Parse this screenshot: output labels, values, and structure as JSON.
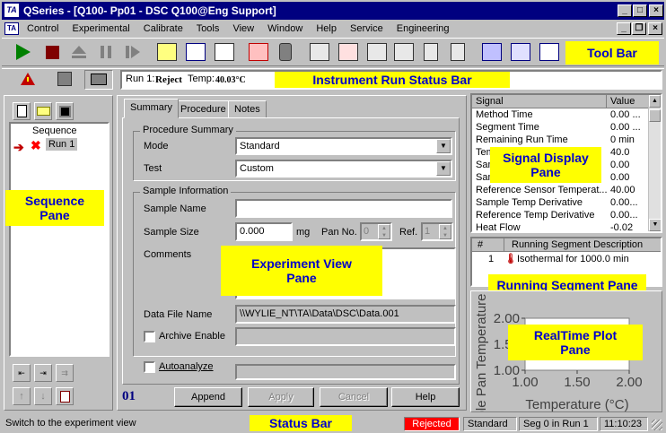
{
  "window": {
    "title": "QSeries - [Q100- Pp01 - DSC Q100@Eng Support]",
    "app_icon": "TA"
  },
  "menu": [
    "Control",
    "Experimental",
    "Calibrate",
    "Tools",
    "View",
    "Window",
    "Help",
    "Service",
    "Engineering"
  ],
  "callouts": {
    "toolbar": "Tool Bar",
    "run_status": "Instrument Run Status Bar",
    "sequence": "Sequence\nPane",
    "signal": "Signal Display\nPane",
    "experiment": "Experiment View\nPane",
    "running_segment": "Running Segment Pane",
    "realtime": "RealTime Plot\nPane",
    "statusbar": "Status Bar"
  },
  "run_status": {
    "run_label": "Run 1:",
    "state": "Reject",
    "temp_label": "Temp:",
    "temp_value": "40.03°C"
  },
  "sequence": {
    "title": "Sequence",
    "run": "Run 1"
  },
  "experiment": {
    "tabs": [
      "Summary",
      "Procedure",
      "Notes"
    ],
    "procedure_summary": "Procedure Summary",
    "mode_label": "Mode",
    "mode_value": "Standard",
    "test_label": "Test",
    "test_value": "Custom",
    "sample_info": "Sample Information",
    "sample_name_label": "Sample Name",
    "sample_name_value": "",
    "sample_size_label": "Sample Size",
    "sample_size_value": "0.000",
    "sample_size_unit": "mg",
    "pan_no_label": "Pan No.",
    "pan_no_value": "0",
    "ref_label": "Ref.",
    "ref_value": "1",
    "comments_label": "Comments",
    "data_file_label": "Data File Name",
    "data_file_value": "\\\\WYLIE_NT\\TA\\Data\\DSC\\Data.001",
    "archive_label": "Archive Enable",
    "autoanalyze_label": "Autoanalyze",
    "run_number": "01",
    "buttons": {
      "append": "Append",
      "apply": "Apply",
      "cancel": "Cancel",
      "help": "Help"
    }
  },
  "signals": {
    "header": [
      "Signal",
      "Value"
    ],
    "rows": [
      [
        "Method Time",
        "0.00 ..."
      ],
      [
        "Segment Time",
        "0.00 ..."
      ],
      [
        "Remaining Run Time",
        "0 min"
      ],
      [
        "Tem",
        "40.0"
      ],
      [
        "Sam",
        "0.00"
      ],
      [
        "Sam",
        "0.00"
      ],
      [
        "Reference Sensor Temperat...",
        "40.00"
      ],
      [
        "Sample Temp Derivative",
        "0.00..."
      ],
      [
        "Reference Temp Derivative",
        "0.00..."
      ],
      [
        "Heat Flow",
        "-0.02"
      ]
    ]
  },
  "running_segment": {
    "header": [
      "#",
      "Running Segment Description"
    ],
    "rows": [
      [
        "1",
        "Isothermal for 1000.0 min"
      ]
    ]
  },
  "chart_data": {
    "type": "line",
    "xlabel": "Temperature (°C)",
    "ylabel": "ple Pan Temperature",
    "xlim": [
      1.0,
      2.0
    ],
    "ylim": [
      1.0,
      2.0
    ],
    "x_ticks": [
      "1.00",
      "1.50",
      "2.00"
    ],
    "y_ticks": [
      "2.00",
      "1.50",
      "1.00"
    ],
    "series": []
  },
  "statusbar": {
    "message": "Switch to the experiment view",
    "state": "Rejected",
    "mode": "Standard",
    "segment": "Seg  0 in Run  1",
    "time": "11:10:23"
  },
  "colors": {
    "titlebar": "#000080",
    "callout_bg": "#ffff00",
    "callout_text": "#0000cc",
    "rejected": "#ff0000"
  }
}
